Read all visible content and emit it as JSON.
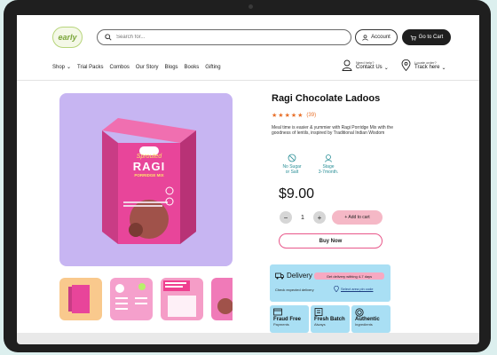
{
  "header": {
    "logo_text": "early",
    "search_placeholder": "Search for...",
    "account_label": "Account",
    "cart_label": "Go to Cart"
  },
  "nav": {
    "items": [
      {
        "label": "Shop"
      },
      {
        "label": "Trial Packs"
      },
      {
        "label": "Combos"
      },
      {
        "label": "Our Story"
      },
      {
        "label": "Blogs"
      },
      {
        "label": "Books"
      },
      {
        "label": "Gifting"
      }
    ],
    "help": {
      "small": "Need help?",
      "label": "Contact Us"
    },
    "locate": {
      "small": "Locate order?",
      "label": "Track here"
    }
  },
  "product": {
    "title": "Ragi Chocolate Ladoos",
    "rating_stars": 5,
    "rating_count": "(39)",
    "description": "Meal time is easier & yummier with Ragi Porridge Mix with the goodness of lentils, inspired by Traditional Indian Wisdom",
    "features": [
      {
        "line1": "No Sugar",
        "line2": "or Salt",
        "icon": "no-sugar-icon"
      },
      {
        "line1": "Stage",
        "line2": "3-7month.",
        "icon": "baby-icon"
      }
    ],
    "price": "$9.00",
    "quantity": "1",
    "add_to_cart": "+ Add to cart",
    "buy_now": "Buy Now",
    "box_text": {
      "sprouted": "Sprouted",
      "ragi": "RAGI",
      "porridge": "PORRIDGE MIX"
    }
  },
  "delivery": {
    "title": "Delivery",
    "badge": "Get delivery withing 4-7 days",
    "check": "Check expected delivery",
    "pin_link": "Select area pin code"
  },
  "badges": [
    {
      "title": "Fraud Free",
      "sub": "Payments"
    },
    {
      "title": "Fresh Batch",
      "sub": "Always"
    },
    {
      "title": "Authentic",
      "sub": "Ingredients"
    }
  ],
  "colors": {
    "accent_pink": "#e8578a",
    "image_bg": "#c7b5f2",
    "info_blue": "#a9dff4",
    "star_orange": "#e8702a"
  }
}
